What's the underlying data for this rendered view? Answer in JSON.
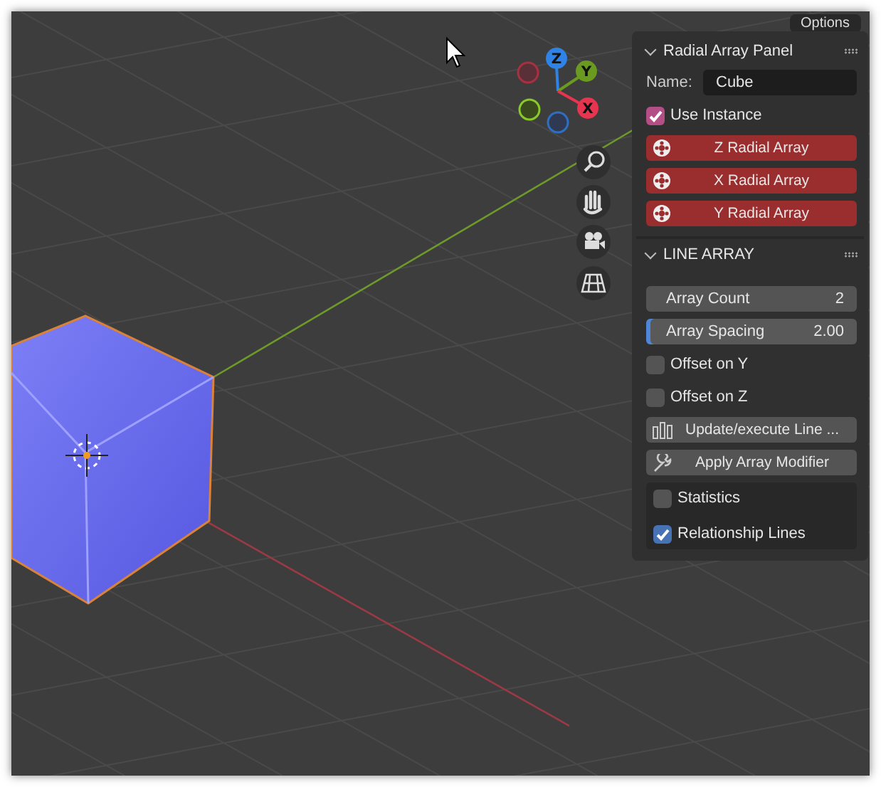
{
  "header_button": "Options",
  "gizmo": {
    "axes": [
      {
        "label": "Z",
        "kind": "z"
      },
      {
        "label": "Y",
        "kind": "y"
      },
      {
        "label": "X",
        "kind": "x"
      }
    ]
  },
  "radial_panel": {
    "title": "Radial Array Panel",
    "expanded": true,
    "name_label": "Name:",
    "name_value": "Cube",
    "use_instance": {
      "label": "Use Instance",
      "checked": true
    },
    "buttons": [
      "Z Radial Array",
      "X Radial Array",
      "Y Radial Array"
    ]
  },
  "line_array": {
    "title": "LINE ARRAY",
    "expanded": true,
    "fields": [
      {
        "label": "Array Count",
        "value": "2",
        "selected": false
      },
      {
        "label": "Array Spacing",
        "value": "2.00",
        "selected": true
      }
    ],
    "checkboxes": [
      {
        "label": "Offset on Y",
        "checked": false
      },
      {
        "label": "Offset on Z",
        "checked": false
      }
    ],
    "buttons": [
      {
        "label": "Update/execute Line ...",
        "kind": "bars"
      },
      {
        "label": "Apply Array Modifier",
        "kind": "wrench"
      }
    ],
    "overlay_options": [
      {
        "label": "Statistics",
        "checked": false
      },
      {
        "label": "Relationship Lines",
        "checked": true
      }
    ]
  }
}
